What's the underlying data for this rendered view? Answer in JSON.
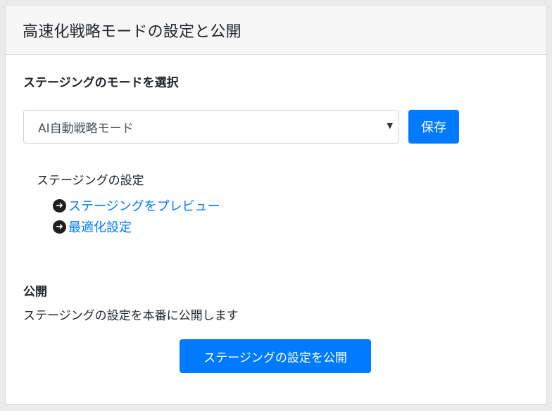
{
  "header": {
    "title": "高速化戦略モードの設定と公開"
  },
  "mode_section": {
    "heading": "ステージングのモードを選択",
    "select_value": "AI自動戦略モード",
    "save_label": "保存"
  },
  "staging_settings": {
    "label": "ステージングの設定",
    "links": [
      {
        "label": "ステージングをプレビュー",
        "icon": "circle-arrow-right-icon"
      },
      {
        "label": "最適化設定",
        "icon": "circle-arrow-right-icon"
      }
    ]
  },
  "publish_section": {
    "heading": "公開",
    "description": "ステージングの設定を本番に公開します",
    "button_label": "ステージングの設定を公開"
  },
  "colors": {
    "primary": "#007bff",
    "header_bg": "#f7f7f7",
    "page_bg": "#ebebeb"
  }
}
